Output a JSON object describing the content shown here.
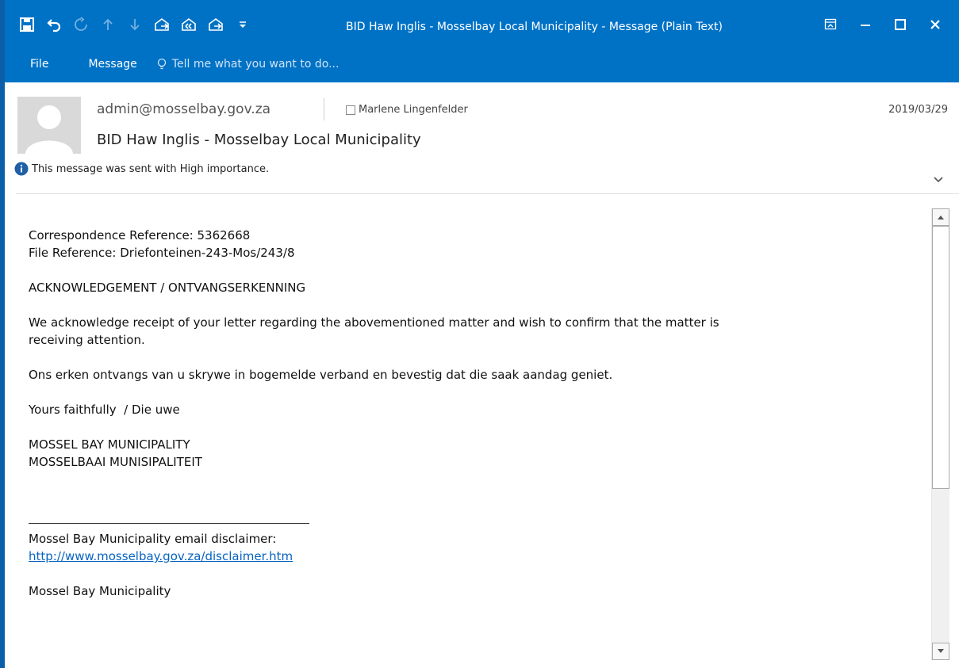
{
  "window": {
    "title": "BID Haw Inglis - Mosselbay Local Municipality - Message (Plain Text)"
  },
  "quick_access": [
    "save-icon",
    "undo-icon",
    "redo-icon",
    "previous-item-icon",
    "next-item-icon",
    "reply-icon",
    "reply-all-icon",
    "forward-icon",
    "customize-qat-icon"
  ],
  "ribbon": {
    "tabs": [
      "File",
      "Message"
    ],
    "tell_me": "Tell me what you want to do..."
  },
  "header": {
    "from": "admin@mosselbay.gov.za",
    "to": "Marlene Lingenfelder",
    "date": "2019/03/29",
    "subject": "BID Haw Inglis - Mosselbay Local Municipality",
    "importance": "This message was sent with High importance."
  },
  "body": {
    "lines1": [
      "Correspondence Reference: 5362668",
      "File Reference: Driefonteinen-243-Mos/243/8"
    ],
    "ack": "ACKNOWLEDGEMENT / ONTVANGSERKENNING",
    "para_en_1": "We acknowledge receipt of your letter regarding the abovementioned matter and wish to confirm that the matter is",
    "para_en_2": "receiving attention.",
    "para_af": "Ons erken ontvangs van u skrywe in bogemelde verband en bevestig dat die saak aandag geniet.",
    "closing": "Yours faithfully  / Die uwe",
    "org_en": "MOSSEL BAY MUNICIPALITY",
    "org_af": "MOSSELBAAI MUNISIPALITEIT",
    "disclaimer_label": "Mossel Bay Municipality email disclaimer:",
    "disclaimer_link": "http://www.mosselbay.gov.za/disclaimer.htm",
    "cut_line": "Mossel Bay Municipality"
  },
  "colors": {
    "titlebar": "#0072C6",
    "link": "#0563C1"
  }
}
